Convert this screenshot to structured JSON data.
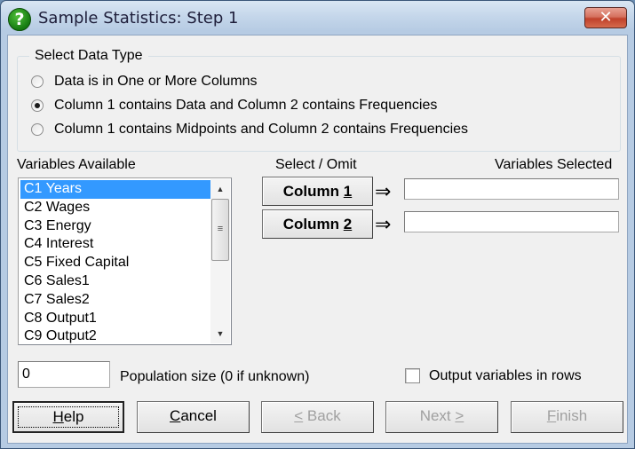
{
  "window": {
    "title": "Sample Statistics: Step 1",
    "icon": "help-question-icon",
    "close_glyph": "✕"
  },
  "data_type_group": {
    "legend": "Select Data Type",
    "options": [
      {
        "label": "Data is in One or More Columns",
        "checked": false
      },
      {
        "label": "Column 1 contains Data and Column 2 contains Frequencies",
        "checked": true
      },
      {
        "label": "Column 1 contains Midpoints and Column 2 contains Frequencies",
        "checked": false
      }
    ]
  },
  "variables_available": {
    "label": "Variables Available",
    "items": [
      {
        "label": "C1 Years",
        "selected": true
      },
      {
        "label": "C2 Wages",
        "selected": false
      },
      {
        "label": "C3 Energy",
        "selected": false
      },
      {
        "label": "C4 Interest",
        "selected": false
      },
      {
        "label": "C5 Fixed Capital",
        "selected": false
      },
      {
        "label": "C6 Sales1",
        "selected": false
      },
      {
        "label": "C7 Sales2",
        "selected": false
      },
      {
        "label": "C8 Output1",
        "selected": false
      },
      {
        "label": "C9 Output2",
        "selected": false
      }
    ],
    "scroll_up_glyph": "▲",
    "scroll_down_glyph": "▼",
    "thumb_grip": "≡"
  },
  "select_omit": {
    "label": "Select / Omit",
    "variables_selected_label": "Variables Selected",
    "arrow_glyph": "⇒",
    "column1": {
      "prefix": "Column ",
      "mnemonic": "1",
      "value": ""
    },
    "column2": {
      "prefix": "Column ",
      "mnemonic": "2",
      "value": ""
    }
  },
  "population": {
    "value": "0",
    "label": "Population size (0 if unknown)"
  },
  "output_rows": {
    "label": "Output variables in rows",
    "checked": false
  },
  "buttons": {
    "help": {
      "mnemonic": "H",
      "rest": "elp"
    },
    "cancel": {
      "mnemonic": "C",
      "rest": "ancel"
    },
    "back": {
      "mnemonic": "<",
      "rest": " Back"
    },
    "next": {
      "pre": "Next ",
      "mnemonic": ">"
    },
    "finish": {
      "mnemonic": "F",
      "rest": "inish"
    }
  }
}
